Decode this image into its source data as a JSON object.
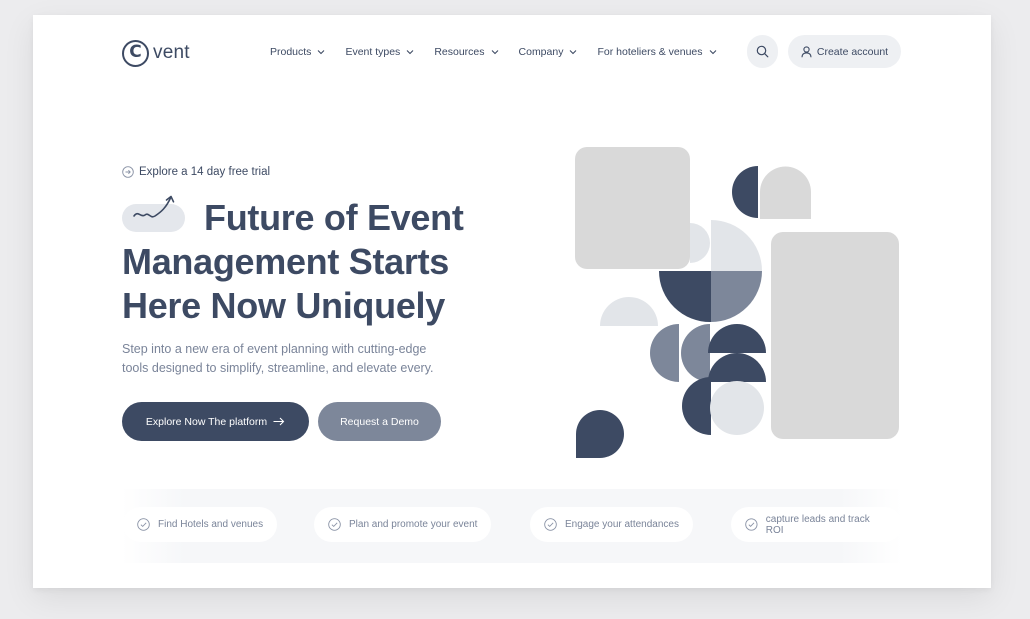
{
  "brand": {
    "mark": "C",
    "name": "vent"
  },
  "nav": {
    "items": [
      {
        "label": "Products"
      },
      {
        "label": "Event types"
      },
      {
        "label": "Resources"
      },
      {
        "label": "Company"
      },
      {
        "label": "For hoteliers & venues"
      }
    ],
    "search_icon": "search-icon",
    "create_account_label": "Create account"
  },
  "hero": {
    "trial_label": "Explore a 14 day free trial",
    "title_line1": "Future of Event",
    "title_line2": "Management Starts",
    "title_line3": "Here Now Uniquely",
    "subtitle": "Step into a new era of event planning with cutting-edge tools designed to simplify, streamline, and elevate every.",
    "primary_button": "Explore Now The platform",
    "secondary_button": "Request a Demo"
  },
  "features": [
    {
      "label": "Find Hotels and venues"
    },
    {
      "label": "Plan and promote your event"
    },
    {
      "label": "Engage your attendances"
    },
    {
      "label": "capture leads and track ROI"
    }
  ],
  "colors": {
    "navy": "#3d4a63",
    "slate": "#7d879a",
    "light_gray": "#d9d9d9",
    "pale_gray": "#e2e5e9",
    "background": "#ececee"
  }
}
